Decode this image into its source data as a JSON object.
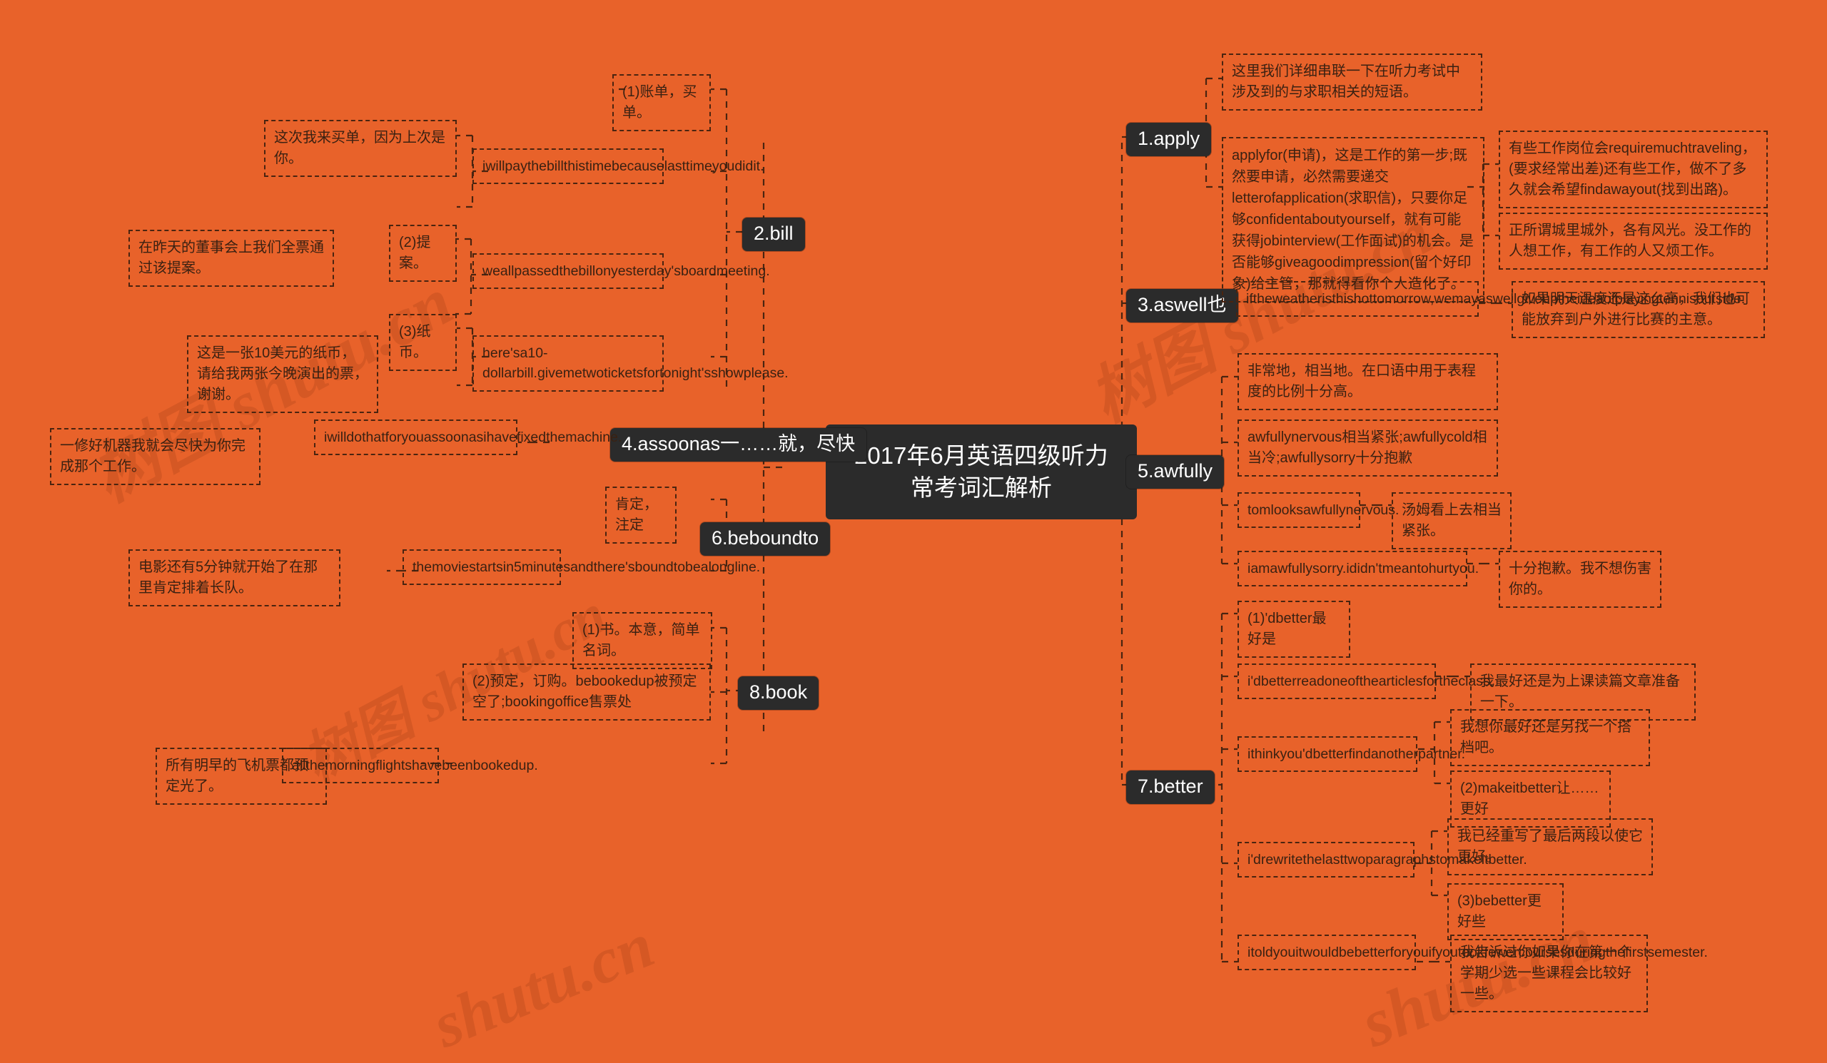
{
  "meta": {
    "background_color": "#e8622a",
    "node_fill": "#2b2b2b",
    "node_text_color": "#ffffff",
    "leaf_border_color": "#4a2410",
    "leaf_text_color": "#3a2112"
  },
  "watermarks": [
    "树图 shutu.cn",
    "树图 shutu.cn",
    "树图 shutu.cn",
    "shutu.cn",
    "shutu.cn"
  ],
  "root": {
    "title": "2017年6月英语四级听力\n常考词汇解析"
  },
  "topics": {
    "apply": "1.apply",
    "bill": "2.bill",
    "aswell": "3.aswell也",
    "assoonas": "4.assoonas一……就，尽快",
    "awfully": "5.awfully",
    "beboundto": "6.beboundto",
    "better": "7.better",
    "book": "8.book"
  },
  "leaves": {
    "apply_intro": "这里我们详细串联一下在听力考试中涉及到的与求职相关的短语。",
    "apply_main": "applyfor(申请)，这是工作的第一步;既然要申请，必然需要递交letterofapplication(求职信)，只要你足够confidentaboutyourself，就有可能获得jobinterview(工作面试)的机会。是否能够giveagoodimpression(留个好印象)给主管，那就得看你个人造化了。",
    "apply_travel": "有些工作岗位会requiremuchtraveling，(要求经常出差)还有些工作，做不了多久就会希望findawayout(找到出路)。",
    "apply_city": "正所谓城里城外，各有风光。没工作的人想工作，有工作的人又烦工作。",
    "aswell_en": "iftheweatheristhishottomorrow,wemayaswellgiveuptheideaofplayingtennisoutside.",
    "aswell_cn": "如果明天温度还是这么高，我们也可能放弃到户外进行比赛的主意。",
    "awfully_def": "非常地，相当地。在口语中用于表程度的比例十分高。",
    "awfully_uses": "awfullynervous相当紧张;awfullycold相当冷;awfullysorry十分抱歉",
    "awfully_ex1_en": "tomlooksawfullynervous.",
    "awfully_ex1_cn": "汤姆看上去相当紧张。",
    "awfully_ex2_en": "iamawfullysorry.ididn'tmeantohurtyou.",
    "awfully_ex2_cn": "十分抱歉。我不想伤害你的。",
    "better_1": "(1)'dbetter最好是",
    "better_ex1_en": "i'dbetterreadoneofthearticlesfortheclass.",
    "better_ex1_cn": "我最好还是为上课读篇文章准备一下。",
    "better_ex2_en": "ithinkyou'dbetterfindanotherpartner.",
    "better_ex2_cn": "我想你最好还是另找一个搭档吧。",
    "better_2": "(2)makeitbetter让……更好",
    "better_ex3_en": "i'drewritethelasttwoparagraphstomakeitbetter.",
    "better_ex3_cn": "我已经重写了最后两段以使它更好。",
    "better_3": "(3)bebetter更好些",
    "better_ex4_en": "itoldyouitwouldbebetterforyouifyoutookfewercoursesduringthefirstsemester.",
    "better_ex4_cn": "我告诉过你如果你在第一个学期少选一些课程会比较好一些。",
    "bill_1": "(1)账单，买单。",
    "bill_ex1_cn": "这次我来买单，因为上次是你。",
    "bill_ex1_en": "iwillpaythebillthistimebecauselasttimeyoudidit.",
    "bill_2": "(2)提案。",
    "bill_ex2_cn": "在昨天的董事会上我们全票通过该提案。",
    "bill_ex2_en": "weallpassedthebillonyesterday'sboardmeeting.",
    "bill_3": "(3)纸币。",
    "bill_ex3_cn": "这是一张10美元的纸币，请给我两张今晚演出的票，谢谢。",
    "bill_ex3_en": "here'sa10-dollarbill.givemetwoticketsfortonight'sshowplease.",
    "assoonas_cn": "一修好机器我就会尽快为你完成那个工作。",
    "assoonas_en": "iwilldothatforyouassoonasihavefixedthemachine.",
    "bound_def": "肯定，注定",
    "bound_cn": "电影还有5分钟就开始了在那里肯定排着长队。",
    "bound_en": "themoviestartsin5minutesandthere'sboundtobealongline.",
    "book_1": "(1)书。本意，简单名词。",
    "book_2": "(2)预定，订购。bebookedup被预定空了;bookingoffice售票处",
    "book_ex_cn": "所有明早的飞机票都预定光了。",
    "book_ex_en": "allthemorningflightshavebeenbookedup."
  }
}
